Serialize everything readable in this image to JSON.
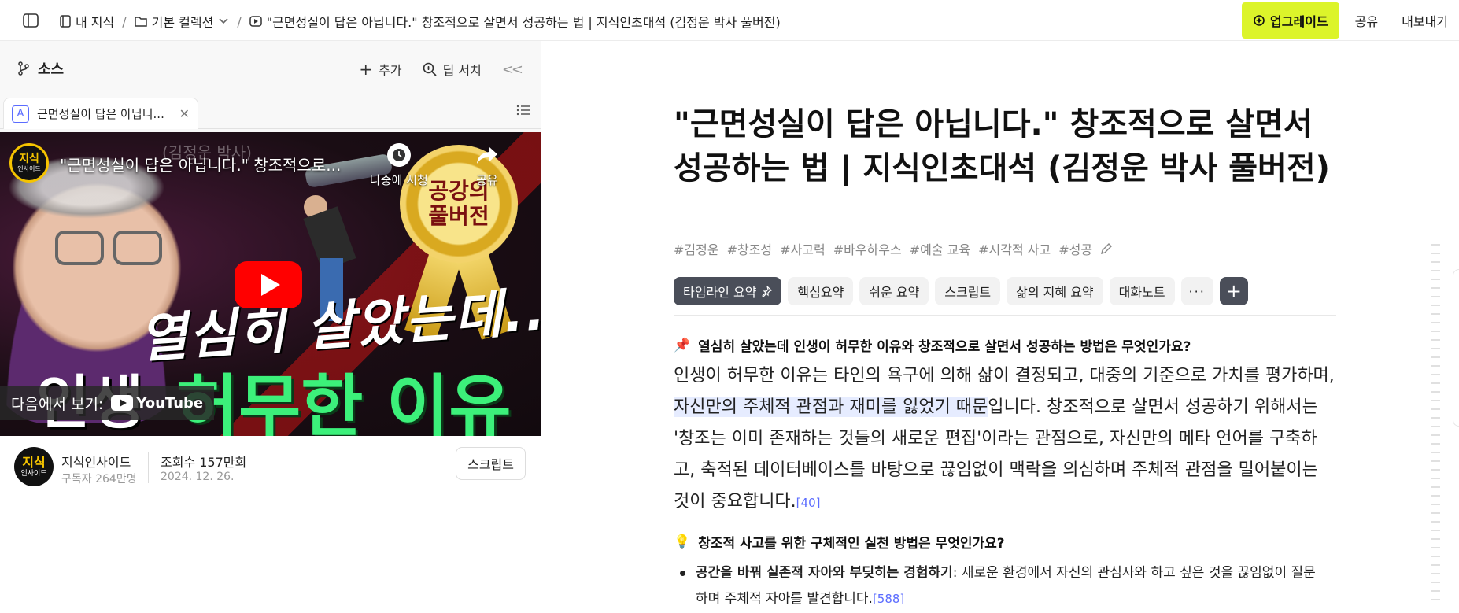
{
  "topbar": {
    "breadcrumb": {
      "my_knowledge": "내 지식",
      "collection": "기본 컬렉션",
      "current": "\"근면성실이 답은 아닙니다.\" 창조적으로 살면서 성공하는 법 | 지식인초대석 (김정운 박사 풀버전)"
    },
    "upgrade_label": "업그레이드",
    "share_label": "공유",
    "export_label": "내보내기",
    "accent_color": "#dcf42a"
  },
  "sources": {
    "title": "소스",
    "add_label": "추가",
    "deep_search_label": "딥 서치",
    "tab": {
      "badge": "A",
      "label": "근면성실이 답은 아닙니..."
    }
  },
  "video": {
    "channel_logo": {
      "line1": "지식",
      "line2": "인사이드"
    },
    "title": "\"근면성실이 답은 아닙니다.\" 창조적으로...",
    "faint_overlay": "(김정운 박사)",
    "watch_later": "나중에 시청",
    "share": "공유",
    "medal_line1": "공강의",
    "medal_line2": "풀버전",
    "handwriting": "열심히 살았는데..",
    "headline_white": "인생",
    "headline_green": "허무한 이유",
    "watch_on": "다음에서 보기:",
    "youtube": "YouTube"
  },
  "channel": {
    "name": "지식인사이드",
    "subscribers": "구독자 264만명",
    "views": "조회수 157만회",
    "date": "2024. 12. 26.",
    "script_button": "스크립트"
  },
  "document": {
    "title": "\"근면성실이 답은 아닙니다.\" 창조적으로 살면서 성공하는 법 | 지식인초대석 (김정운 박사 풀버전)",
    "tags": [
      "#김정운",
      "#창조성",
      "#사고력",
      "#바우하우스",
      "#예술 교육",
      "#시각적 사고",
      "#성공"
    ],
    "chips": [
      "타임라인 요약",
      "핵심요약",
      "쉬운 요약",
      "스크립트",
      "삶의 지혜 요약",
      "대화노트"
    ],
    "more_label": "···",
    "add_label": "+",
    "q1": {
      "emoji": "📌",
      "text": "열심히 살았는데 인생이 허무한 이유와 창조적으로 살면서 성공하는 방법은 무엇인가요?"
    },
    "answer": {
      "part1": "인생이 허무한 이유는 타인의 욕구에 의해 삶이 결정되고, 대중의 기준으로 가치를 평가하며, ",
      "highlight": "자신만의 주체적 관점과 재미를 잃었기 때문",
      "part2": "입니다. 창조적으로 살면서 성공하기 위해서는 '창조는 이미 존재하는 것들의 새로운 편집'이라는 관점으로, 자신만의 메타 언어를 구축하고, 축적된 데이터베이스를 바탕으로 끊임없이 맥락을 의심하며 주체적 관점을 밀어붙이는 것이 중요합니다.",
      "citation": "[40]"
    },
    "q2": {
      "emoji": "💡",
      "text": "창조적 사고를 위한 구체적인 실천 방법은 무엇인가요?"
    },
    "bullet1": {
      "bold": "공간을 바꿔 실존적 자아와 부딪히는 경험하기",
      "text": ": 새로운 환경에서 자신의 관심사와 하고 싶은 것을 끊임없이 질문하며 주체적 자아를 발견합니다.",
      "citation": "[588]"
    }
  }
}
